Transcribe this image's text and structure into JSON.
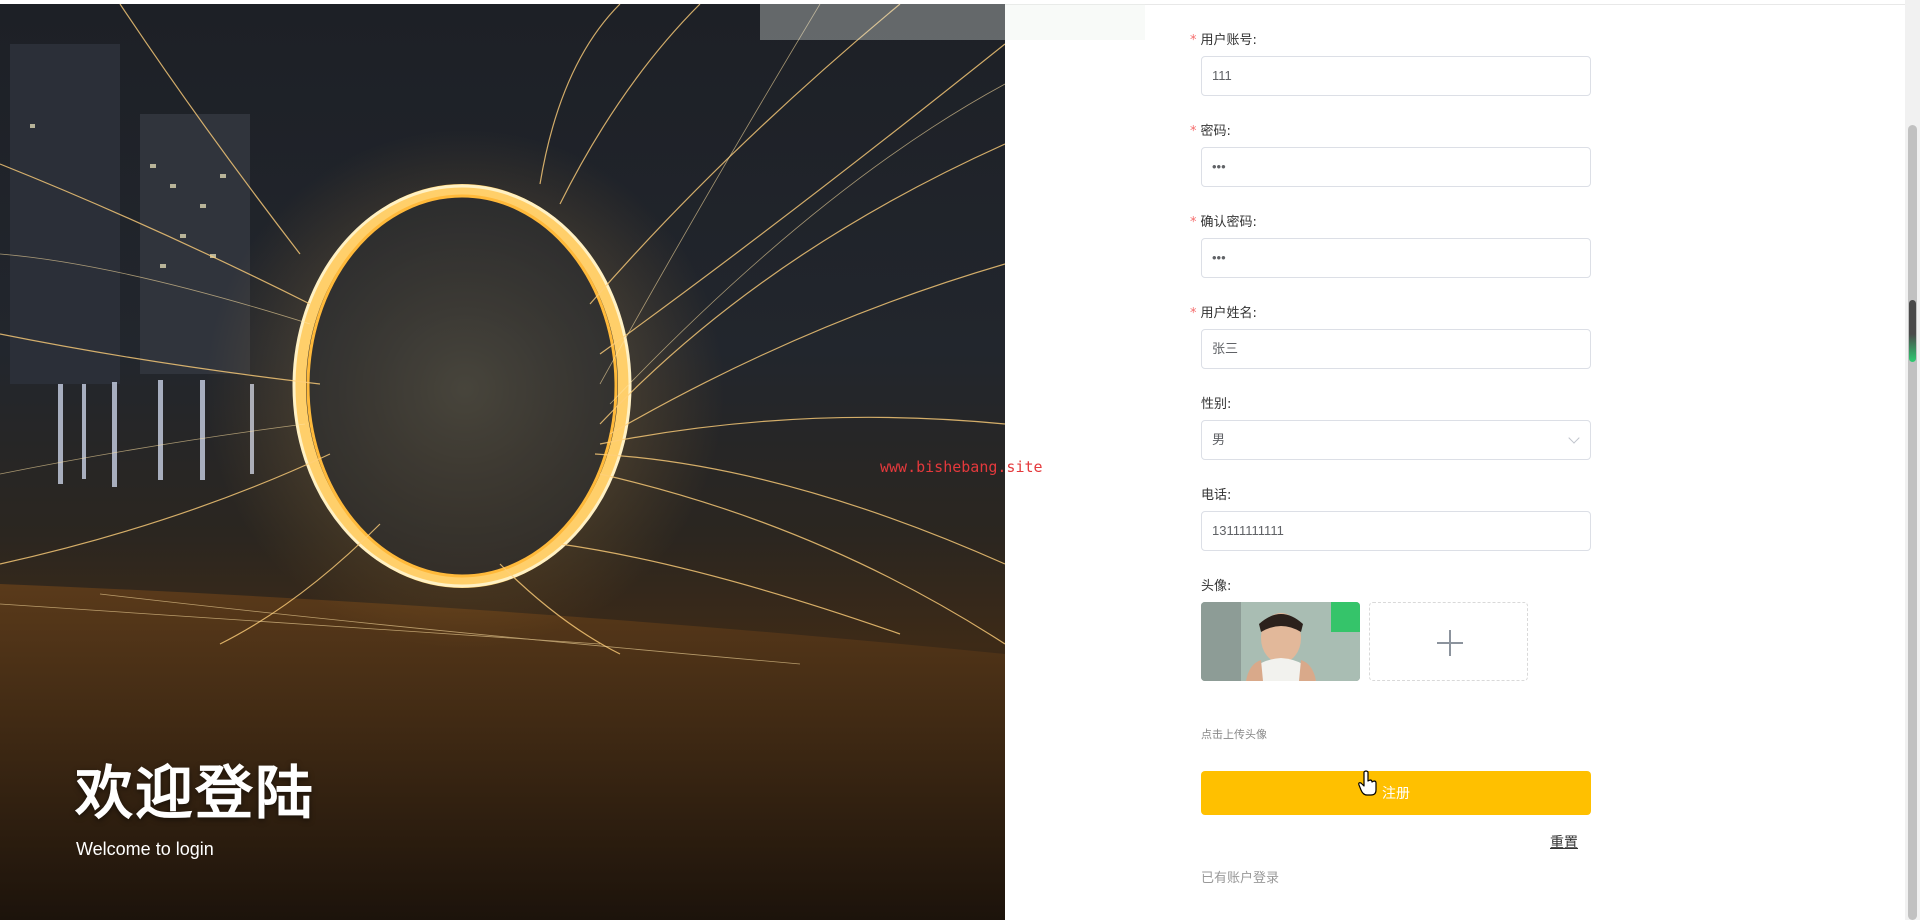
{
  "hero": {
    "title": "欢迎登陆",
    "subtitle": "Welcome to login",
    "watermark": "www.bishebang.site"
  },
  "form": {
    "account": {
      "label": "用户账号:",
      "value": "111",
      "required": true
    },
    "password": {
      "label": "密码:",
      "value": "•••",
      "required": true
    },
    "confirm_password": {
      "label": "确认密码:",
      "value": "•••",
      "required": true
    },
    "name": {
      "label": "用户姓名:",
      "value": "张三",
      "required": true
    },
    "gender": {
      "label": "性别:",
      "value": "男",
      "required": false
    },
    "phone": {
      "label": "电话:",
      "value": "13111111111",
      "required": false
    },
    "avatar": {
      "label": "头像:",
      "hint": "点击上传头像"
    },
    "register_label": "注册",
    "reset_label": "重置",
    "login_link": "已有账户登录",
    "required_mark": "*"
  },
  "colors": {
    "primary_button": "#ffc000",
    "required_mark": "#f56c6c",
    "watermark": "#e4393c"
  }
}
